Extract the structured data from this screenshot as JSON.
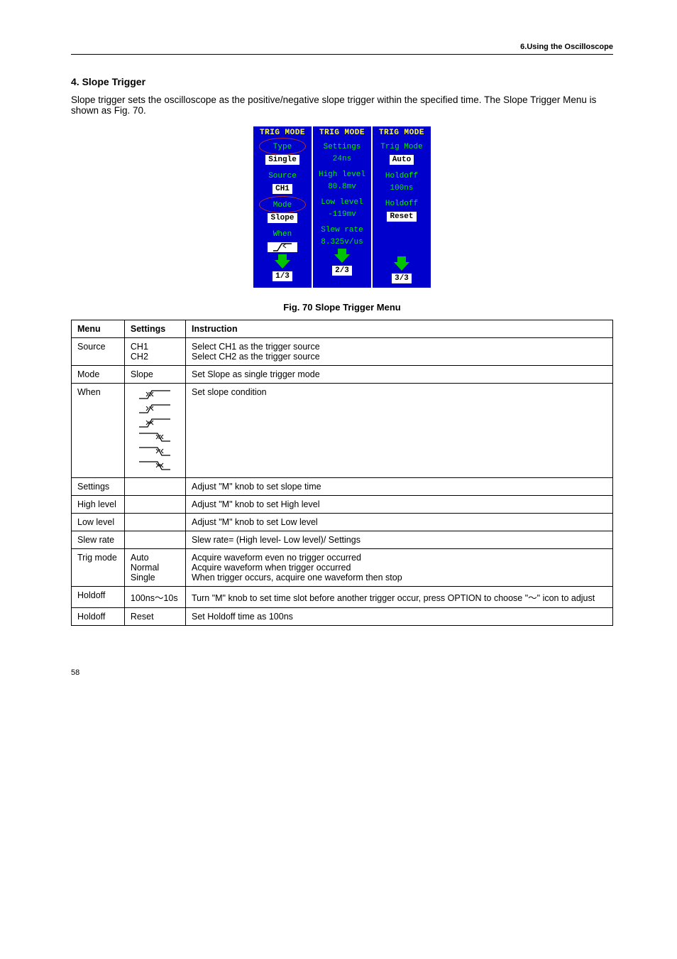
{
  "header": {
    "left": "",
    "right": "6.Using the Oscilloscope"
  },
  "section_title": "4. Slope Trigger",
  "intro": "Slope trigger sets the oscilloscope as the positive/negative slope trigger within the specified time. The Slope Trigger Menu is shown as Fig. 70.",
  "menus": [
    {
      "title": "TRIG MODE",
      "rows": [
        {
          "label": "Type",
          "value": "Single",
          "style": "box",
          "circle": true
        },
        {
          "label": "Source",
          "value": "CH1",
          "style": "box"
        },
        {
          "label": "Mode",
          "value": "Slope",
          "style": "box",
          "circle": true
        },
        {
          "label": "When",
          "value": "icon",
          "style": "icon"
        }
      ],
      "page": "1/3"
    },
    {
      "title": "TRIG MODE",
      "rows": [
        {
          "label": "Settings",
          "value": "24ns",
          "style": "green"
        },
        {
          "label": "High level",
          "value": "80.8mv",
          "style": "green"
        },
        {
          "label": "Low level",
          "value": "-119mv",
          "style": "green"
        },
        {
          "label": "Slew rate",
          "value": "8.325v/us",
          "style": "green"
        }
      ],
      "page": "2/3"
    },
    {
      "title": "TRIG MODE",
      "rows": [
        {
          "label": "Trig Mode",
          "value": "Auto",
          "style": "box"
        },
        {
          "label": "Holdoff",
          "value": "100ns",
          "style": "green"
        },
        {
          "label": "Holdoff",
          "value": "Reset",
          "style": "box"
        },
        {
          "label": "",
          "value": "",
          "style": "blank"
        }
      ],
      "page": "3/3"
    }
  ],
  "caption": "Fig. 70 Slope Trigger Menu",
  "table": {
    "menu_label": "Menu",
    "settings_label": "Settings",
    "instruction_label": "Instruction",
    "rows": [
      {
        "menu": "Source",
        "settings": "CH1\nCH2",
        "instruction": "Select CH1 as the trigger source\nSelect CH2 as the trigger source"
      },
      {
        "menu": "Mode",
        "settings": "Slope",
        "instruction": "Set Slope as single trigger mode"
      },
      {
        "menu": "When",
        "settings": "ICONS",
        "instruction": "Set slope condition"
      },
      {
        "menu": "Settings",
        "settings": "",
        "instruction": "Adjust \"M\" knob to set slope time"
      },
      {
        "menu": "High level",
        "settings": "",
        "instruction": "Adjust \"M\" knob to set High level"
      },
      {
        "menu": "Low level",
        "settings": "",
        "instruction": "Adjust \"M\" knob to set Low level"
      },
      {
        "menu": "Slew rate",
        "settings": "",
        "instruction": "Slew rate= (High level- Low level)/ Settings"
      },
      {
        "menu": "Trig mode",
        "settings": "Auto\nNormal\nSingle",
        "instruction": "Acquire waveform even no trigger occurred\nAcquire waveform when trigger occurred\nWhen trigger occurs, acquire one waveform then stop"
      },
      {
        "menu": "Holdoff",
        "settings": "100ns～10s",
        "instruction": "Turn \"M\" knob to set time slot before another trigger occur, press OPTION to choose \"～\" icon to adjust"
      },
      {
        "menu": "Holdoff",
        "settings": "Reset",
        "instruction": "Set Holdoff time as 100ns"
      }
    ]
  },
  "footer": {
    "page": "58",
    "copyright": ""
  },
  "says_slope_icon": "when-condition-icon"
}
